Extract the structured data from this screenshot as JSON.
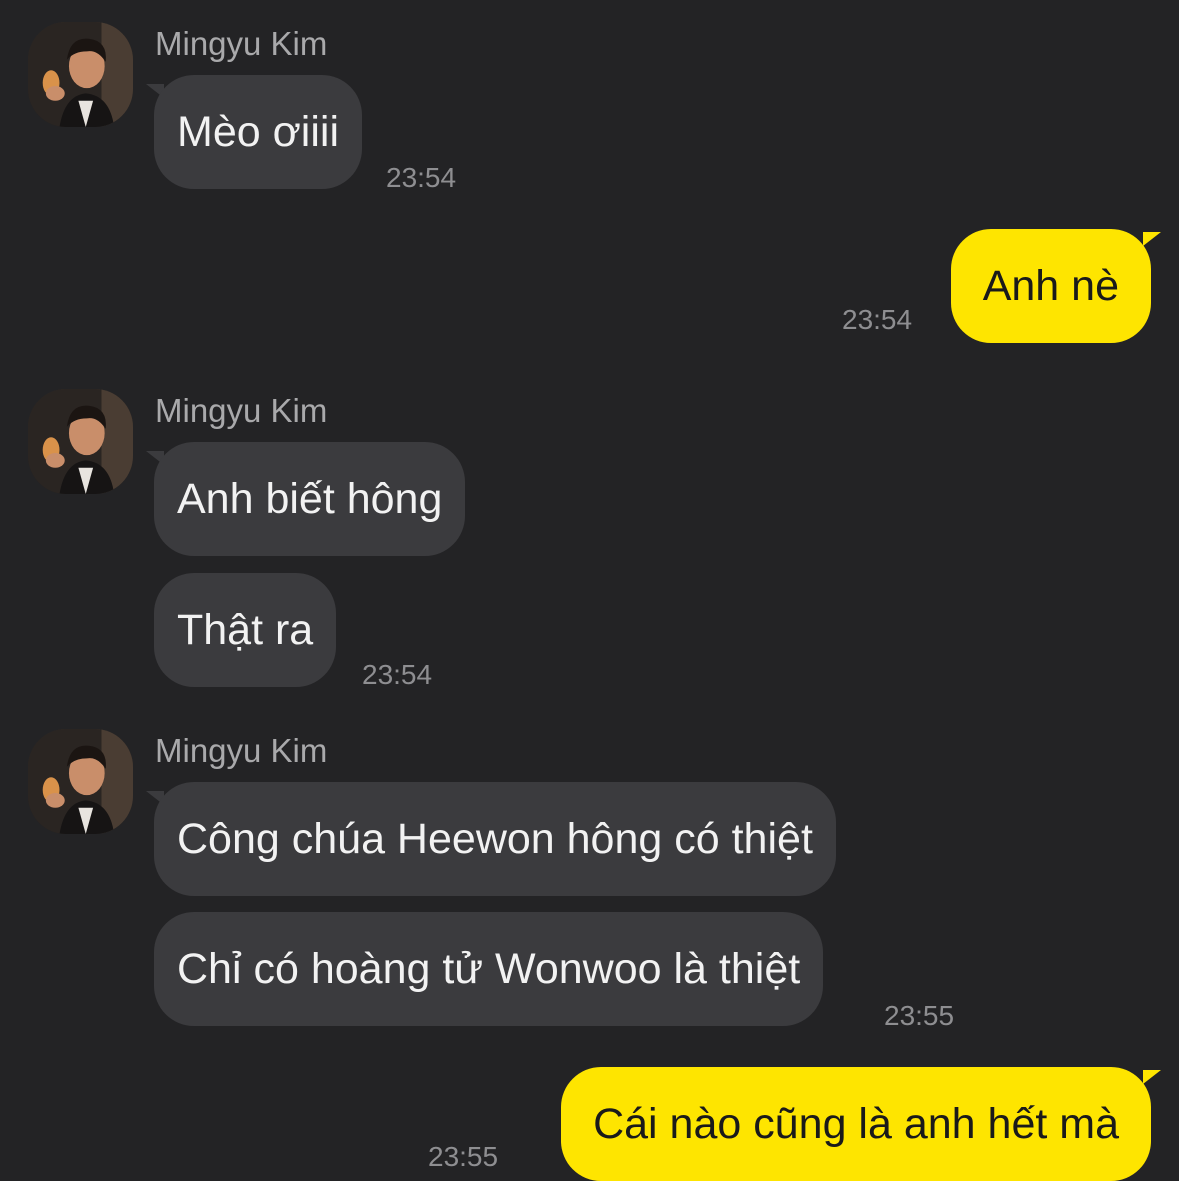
{
  "chat": {
    "sender_name": "Mingyu Kim",
    "avatar_icon": "profile-photo",
    "colors": {
      "background": "#232325",
      "incoming_bubble": "#3b3b3e",
      "outgoing_bubble": "#fee500",
      "timestamp": "#8e8e91",
      "sender_name": "#a9a9ab"
    },
    "groups": [
      {
        "direction": "incoming",
        "sender": "Mingyu Kim",
        "messages": [
          "Mèo ơiiii"
        ],
        "time": "23:54"
      },
      {
        "direction": "outgoing",
        "messages": [
          "Anh nè"
        ],
        "time": "23:54"
      },
      {
        "direction": "incoming",
        "sender": "Mingyu Kim",
        "messages": [
          "Anh biết hông",
          "Thật ra"
        ],
        "time": "23:54"
      },
      {
        "direction": "incoming",
        "sender": "Mingyu Kim",
        "messages": [
          "Công chúa Heewon hông có thiệt",
          "Chỉ có hoàng tử Wonwoo là thiệt"
        ],
        "time": "23:55"
      },
      {
        "direction": "outgoing",
        "messages": [
          "Cái nào cũng là anh hết mà"
        ],
        "time": "23:55"
      }
    ]
  }
}
